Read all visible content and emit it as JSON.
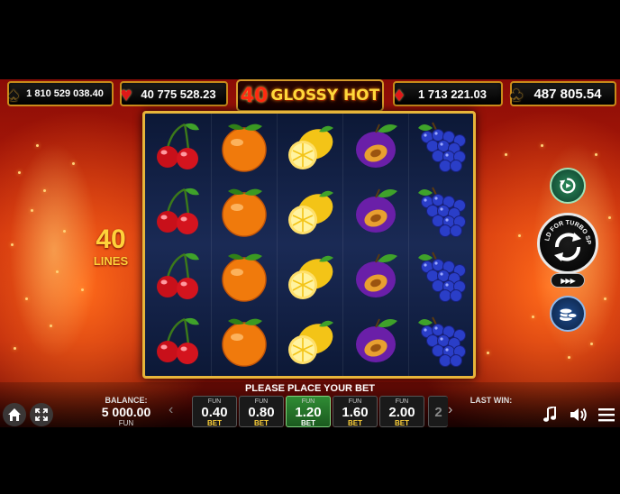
{
  "jackpots": [
    {
      "suit": "spade-icon",
      "value": "1 810 529 038.40"
    },
    {
      "suit": "heart-icon",
      "value": "40 775 528.23"
    },
    {
      "suit": "diamond-icon",
      "value": "1 713 221.03"
    },
    {
      "suit": "club-icon",
      "value": "487 805.54"
    }
  ],
  "logo": {
    "number": "40",
    "text": "GLOSSY HOT"
  },
  "lines": {
    "count": "40",
    "label": "LINES"
  },
  "reels": [
    [
      "cherry",
      "cherry",
      "cherry",
      "cherry"
    ],
    [
      "orange",
      "orange",
      "orange",
      "orange"
    ],
    [
      "lemon",
      "lemon",
      "lemon",
      "lemon"
    ],
    [
      "plum",
      "plum",
      "plum",
      "plum"
    ],
    [
      "grapes",
      "grapes",
      "grapes",
      "grapes"
    ]
  ],
  "buttons": {
    "autoplay": "autoplay-icon",
    "spin_label": "HOLD FOR TURBO SPIN",
    "turbo": "▶▶▶",
    "coins": "coins-icon"
  },
  "bottom": {
    "place_bet": "PLEASE PLACE YOUR BET",
    "balance_label": "BALANCE:",
    "balance_value": "5 000.00",
    "balance_currency": "FUN",
    "last_win_label": "LAST WIN:",
    "bet_prev": "‹",
    "bet_next": "›",
    "bets": [
      {
        "cur": "FUN",
        "amount": "0.40",
        "label": "BET",
        "selected": false
      },
      {
        "cur": "FUN",
        "amount": "0.80",
        "label": "BET",
        "selected": false
      },
      {
        "cur": "FUN",
        "amount": "1.20",
        "label": "BET",
        "selected": true
      },
      {
        "cur": "FUN",
        "amount": "1.60",
        "label": "BET",
        "selected": false
      },
      {
        "cur": "FUN",
        "amount": "2.00",
        "label": "BET",
        "selected": false
      }
    ],
    "bet_partial": "2"
  },
  "colors": {
    "accent": "#ffd23a",
    "selected_bet": "#2f8c34",
    "frame": "#e7b53a"
  }
}
